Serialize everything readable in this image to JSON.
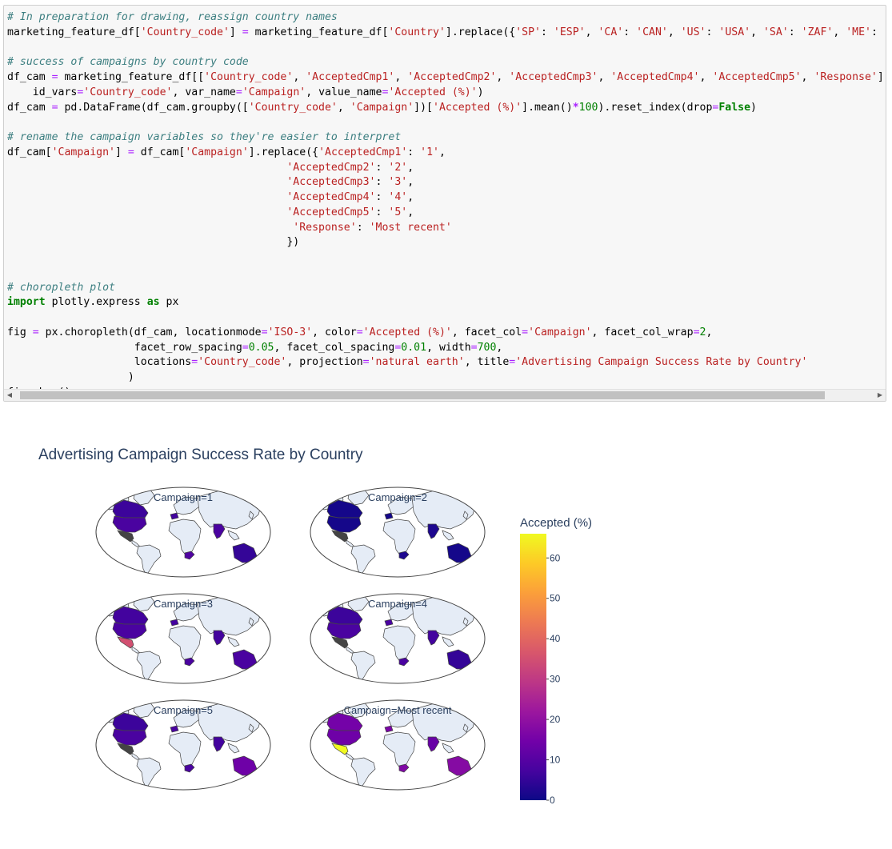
{
  "code_lines": [
    [
      [
        "cm",
        "# In preparation for drawing, reassign country names"
      ]
    ],
    [
      [
        "",
        "marketing_feature_df["
      ],
      [
        "st",
        "'Country_code'"
      ],
      [
        "",
        "] "
      ],
      [
        "eq",
        "="
      ],
      [
        "",
        " marketing_feature_df["
      ],
      [
        "st",
        "'Country'"
      ],
      [
        "",
        "].replace({"
      ],
      [
        "st",
        "'SP'"
      ],
      [
        "",
        ": "
      ],
      [
        "st",
        "'ESP'"
      ],
      [
        "",
        ", "
      ],
      [
        "st",
        "'CA'"
      ],
      [
        "",
        ": "
      ],
      [
        "st",
        "'CAN'"
      ],
      [
        "",
        ", "
      ],
      [
        "st",
        "'US'"
      ],
      [
        "",
        ": "
      ],
      [
        "st",
        "'USA'"
      ],
      [
        "",
        ", "
      ],
      [
        "st",
        "'SA'"
      ],
      [
        "",
        ": "
      ],
      [
        "st",
        "'ZAF'"
      ],
      [
        "",
        ", "
      ],
      [
        "st",
        "'ME'"
      ],
      [
        "",
        ":"
      ]
    ],
    [
      [
        "",
        ""
      ]
    ],
    [
      [
        "cm",
        "# success of campaigns by country code"
      ]
    ],
    [
      [
        "",
        "df_cam "
      ],
      [
        "eq",
        "="
      ],
      [
        "",
        " marketing_feature_df[["
      ],
      [
        "st",
        "'Country_code'"
      ],
      [
        "",
        ", "
      ],
      [
        "st",
        "'AcceptedCmp1'"
      ],
      [
        "",
        ", "
      ],
      [
        "st",
        "'AcceptedCmp2'"
      ],
      [
        "",
        ", "
      ],
      [
        "st",
        "'AcceptedCmp3'"
      ],
      [
        "",
        ", "
      ],
      [
        "st",
        "'AcceptedCmp4'"
      ],
      [
        "",
        ", "
      ],
      [
        "st",
        "'AcceptedCmp5'"
      ],
      [
        "",
        ", "
      ],
      [
        "st",
        "'Response'"
      ],
      [
        "",
        "]"
      ]
    ],
    [
      [
        "",
        "    id_vars"
      ],
      [
        "eq",
        "="
      ],
      [
        "st",
        "'Country_code'"
      ],
      [
        "",
        ", var_name"
      ],
      [
        "eq",
        "="
      ],
      [
        "st",
        "'Campaign'"
      ],
      [
        "",
        ", value_name"
      ],
      [
        "eq",
        "="
      ],
      [
        "st",
        "'Accepted (%)'"
      ],
      [
        "",
        ")"
      ]
    ],
    [
      [
        "",
        "df_cam "
      ],
      [
        "eq",
        "="
      ],
      [
        "",
        " pd.DataFrame(df_cam.groupby(["
      ],
      [
        "st",
        "'Country_code'"
      ],
      [
        "",
        ", "
      ],
      [
        "st",
        "'Campaign'"
      ],
      [
        "",
        "])["
      ],
      [
        "st",
        "'Accepted (%)'"
      ],
      [
        "",
        "].mean()"
      ],
      [
        "op",
        "*"
      ],
      [
        "nm",
        "100"
      ],
      [
        "",
        ").reset_index(drop"
      ],
      [
        "eq",
        "="
      ],
      [
        "kw",
        "False"
      ],
      [
        "",
        ")"
      ]
    ],
    [
      [
        "",
        ""
      ]
    ],
    [
      [
        "cm",
        "# rename the campaign variables so they're easier to interpret"
      ]
    ],
    [
      [
        "",
        "df_cam["
      ],
      [
        "st",
        "'Campaign'"
      ],
      [
        "",
        "] "
      ],
      [
        "eq",
        "="
      ],
      [
        "",
        " df_cam["
      ],
      [
        "st",
        "'Campaign'"
      ],
      [
        "",
        "].replace({"
      ],
      [
        "st",
        "'AcceptedCmp1'"
      ],
      [
        "",
        ": "
      ],
      [
        "st",
        "'1'"
      ],
      [
        "",
        ","
      ]
    ],
    [
      [
        "",
        "                                            "
      ],
      [
        "st",
        "'AcceptedCmp2'"
      ],
      [
        "",
        ": "
      ],
      [
        "st",
        "'2'"
      ],
      [
        "",
        ","
      ]
    ],
    [
      [
        "",
        "                                            "
      ],
      [
        "st",
        "'AcceptedCmp3'"
      ],
      [
        "",
        ": "
      ],
      [
        "st",
        "'3'"
      ],
      [
        "",
        ","
      ]
    ],
    [
      [
        "",
        "                                            "
      ],
      [
        "st",
        "'AcceptedCmp4'"
      ],
      [
        "",
        ": "
      ],
      [
        "st",
        "'4'"
      ],
      [
        "",
        ","
      ]
    ],
    [
      [
        "",
        "                                            "
      ],
      [
        "st",
        "'AcceptedCmp5'"
      ],
      [
        "",
        ": "
      ],
      [
        "st",
        "'5'"
      ],
      [
        "",
        ","
      ]
    ],
    [
      [
        "",
        "                                             "
      ],
      [
        "st",
        "'Response'"
      ],
      [
        "",
        ": "
      ],
      [
        "st",
        "'Most recent'"
      ]
    ],
    [
      [
        "",
        "                                            })"
      ]
    ],
    [
      [
        "",
        ""
      ]
    ],
    [
      [
        "",
        ""
      ]
    ],
    [
      [
        "cm",
        "# choropleth plot"
      ]
    ],
    [
      [
        "kw",
        "import"
      ],
      [
        "",
        " plotly.express "
      ],
      [
        "kw",
        "as"
      ],
      [
        "",
        " px"
      ]
    ],
    [
      [
        "",
        ""
      ]
    ],
    [
      [
        "",
        "fig "
      ],
      [
        "eq",
        "="
      ],
      [
        "",
        " px.choropleth(df_cam, locationmode"
      ],
      [
        "eq",
        "="
      ],
      [
        "st",
        "'ISO-3'"
      ],
      [
        "",
        ", color"
      ],
      [
        "eq",
        "="
      ],
      [
        "st",
        "'Accepted (%)'"
      ],
      [
        "",
        ", facet_col"
      ],
      [
        "eq",
        "="
      ],
      [
        "st",
        "'Campaign'"
      ],
      [
        "",
        ", facet_col_wrap"
      ],
      [
        "eq",
        "="
      ],
      [
        "nm",
        "2"
      ],
      [
        "",
        ","
      ]
    ],
    [
      [
        "",
        "                    facet_row_spacing"
      ],
      [
        "eq",
        "="
      ],
      [
        "nm",
        "0.05"
      ],
      [
        "",
        ", facet_col_spacing"
      ],
      [
        "eq",
        "="
      ],
      [
        "nm",
        "0.01"
      ],
      [
        "",
        ", width"
      ],
      [
        "eq",
        "="
      ],
      [
        "nm",
        "700"
      ],
      [
        "",
        ","
      ]
    ],
    [
      [
        "",
        "                    locations"
      ],
      [
        "eq",
        "="
      ],
      [
        "st",
        "'Country_code'"
      ],
      [
        "",
        ", projection"
      ],
      [
        "eq",
        "="
      ],
      [
        "st",
        "'natural earth'"
      ],
      [
        "",
        ", title"
      ],
      [
        "eq",
        "="
      ],
      [
        "st",
        "'Advertising Campaign Success Rate by Country'"
      ]
    ],
    [
      [
        "",
        "                   )"
      ]
    ],
    [
      [
        "",
        "fig.show()"
      ]
    ]
  ],
  "scrollbar": {
    "left_arrow": "◀",
    "right_arrow": "▶"
  },
  "figure": {
    "title": "Advertising Campaign Success Rate by Country",
    "facets": [
      {
        "label": "Campaign=1",
        "values": {
          "USA": 8,
          "CAN": 6,
          "MEX": 0,
          "ESP": 7,
          "IND": 8,
          "ZAF": 9,
          "AUS": 5
        }
      },
      {
        "label": "Campaign=2",
        "values": {
          "USA": 1,
          "CAN": 1,
          "MEX": 0,
          "ESP": 1,
          "IND": 2,
          "ZAF": 2,
          "AUS": 1
        }
      },
      {
        "label": "Campaign=3",
        "values": {
          "USA": 8,
          "CAN": 7,
          "MEX": 35,
          "ESP": 7,
          "IND": 7,
          "ZAF": 8,
          "AUS": 8
        }
      },
      {
        "label": "Campaign=4",
        "values": {
          "USA": 8,
          "CAN": 6,
          "MEX": 0,
          "ESP": 8,
          "IND": 7,
          "ZAF": 8,
          "AUS": 5
        }
      },
      {
        "label": "Campaign=5",
        "values": {
          "USA": 8,
          "CAN": 6,
          "MEX": 0,
          "ESP": 8,
          "IND": 7,
          "ZAF": 8,
          "AUS": 14
        }
      },
      {
        "label": "Campaign=Most recent",
        "values": {
          "USA": 14,
          "CAN": 15,
          "MEX": 66,
          "ESP": 16,
          "IND": 13,
          "ZAF": 17,
          "AUS": 18
        }
      }
    ],
    "colorbar": {
      "title": "Accepted (%)",
      "ticks": [
        "0",
        "10",
        "20",
        "30",
        "40",
        "50",
        "60"
      ],
      "range": [
        0,
        66
      ],
      "colors": [
        "#0d0887",
        "#46039f",
        "#7201a8",
        "#9c179e",
        "#bd3786",
        "#d8576b",
        "#ed7953",
        "#fb9f3a",
        "#fdca26",
        "#f0f921"
      ]
    },
    "colors": {
      "land": "#e5ecf6",
      "nodata": "#444444",
      "coast": "#444444",
      "title": "#2a3f5f"
    }
  }
}
